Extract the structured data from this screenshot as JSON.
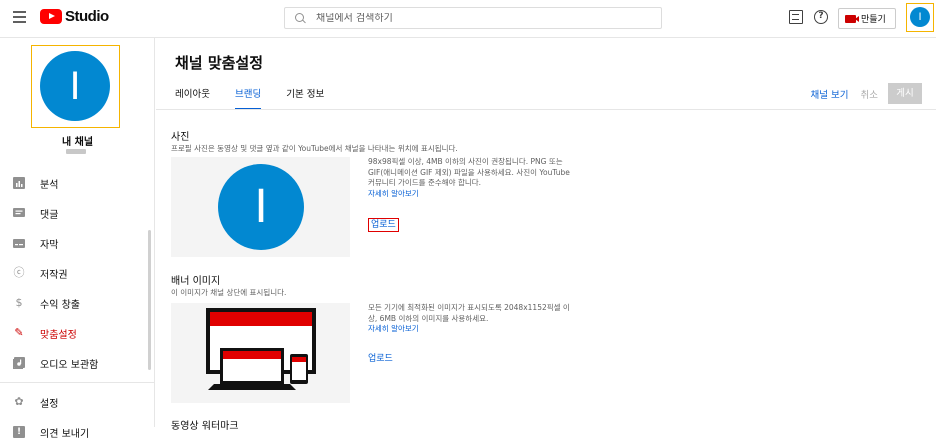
{
  "header": {
    "logo_text": "Studio",
    "search_placeholder": "채널에서 검색하기",
    "create_label": "만들기",
    "avatar_letter": "I",
    "help_glyph": "?"
  },
  "sidebar": {
    "avatar_letter": "I",
    "channel_name": "내 채널",
    "items": [
      {
        "label": "분석",
        "icon": "analytics-icon"
      },
      {
        "label": "댓글",
        "icon": "comments-icon"
      },
      {
        "label": "자막",
        "icon": "subtitles-icon"
      },
      {
        "label": "저작권",
        "icon": "copyright-icon",
        "glyph": "ⓒ"
      },
      {
        "label": "수익 창출",
        "icon": "monetization-icon",
        "glyph": "$"
      },
      {
        "label": "맞춤설정",
        "icon": "customization-icon",
        "glyph": "✎"
      },
      {
        "label": "오디오 보관함",
        "icon": "audio-library-icon"
      },
      {
        "label": "설정",
        "icon": "settings-icon",
        "glyph": "✿"
      },
      {
        "label": "의견 보내기",
        "icon": "feedback-icon",
        "glyph": "!"
      }
    ]
  },
  "main": {
    "title": "채널 맞춤설정",
    "tabs": [
      "레이아웃",
      "브랜딩",
      "기본 정보"
    ],
    "active_tab": "브랜딩",
    "view_channel": "채널 보기",
    "cancel": "취소",
    "publish": "게시",
    "photo": {
      "title": "사진",
      "desc": "프로필 사진은 동영상 및 댓글 옆과 같이 YouTube에서 채널을 나타내는 위치에 표시됩니다.",
      "info": "98x98픽셀 이상, 4MB 이하의 사진이 권장됩니다. PNG 또는 GIF(애니메이션 GIF 제외) 파일을 사용하세요. 사진이 YouTube 커뮤니티 가이드를 준수해야 합니다.",
      "learn_more": "자세히 알아보기",
      "upload": "업로드",
      "avatar_letter": "I"
    },
    "banner": {
      "title": "배너 이미지",
      "desc": "이 이미지가 채널 상단에 표시됩니다.",
      "info": "모든 기기에 최적화된 이미지가 표시되도록 2048x1152픽셀 이상, 6MB 이하의 이미지를 사용하세요.",
      "learn_more": "자세히 알아보기",
      "upload": "업로드"
    },
    "watermark": {
      "title": "동영상 워터마크"
    }
  },
  "colors": {
    "accent": "#065fd4",
    "avatar": "#0288d1",
    "active_red": "#cc0000",
    "highlight": "#f5b400"
  }
}
